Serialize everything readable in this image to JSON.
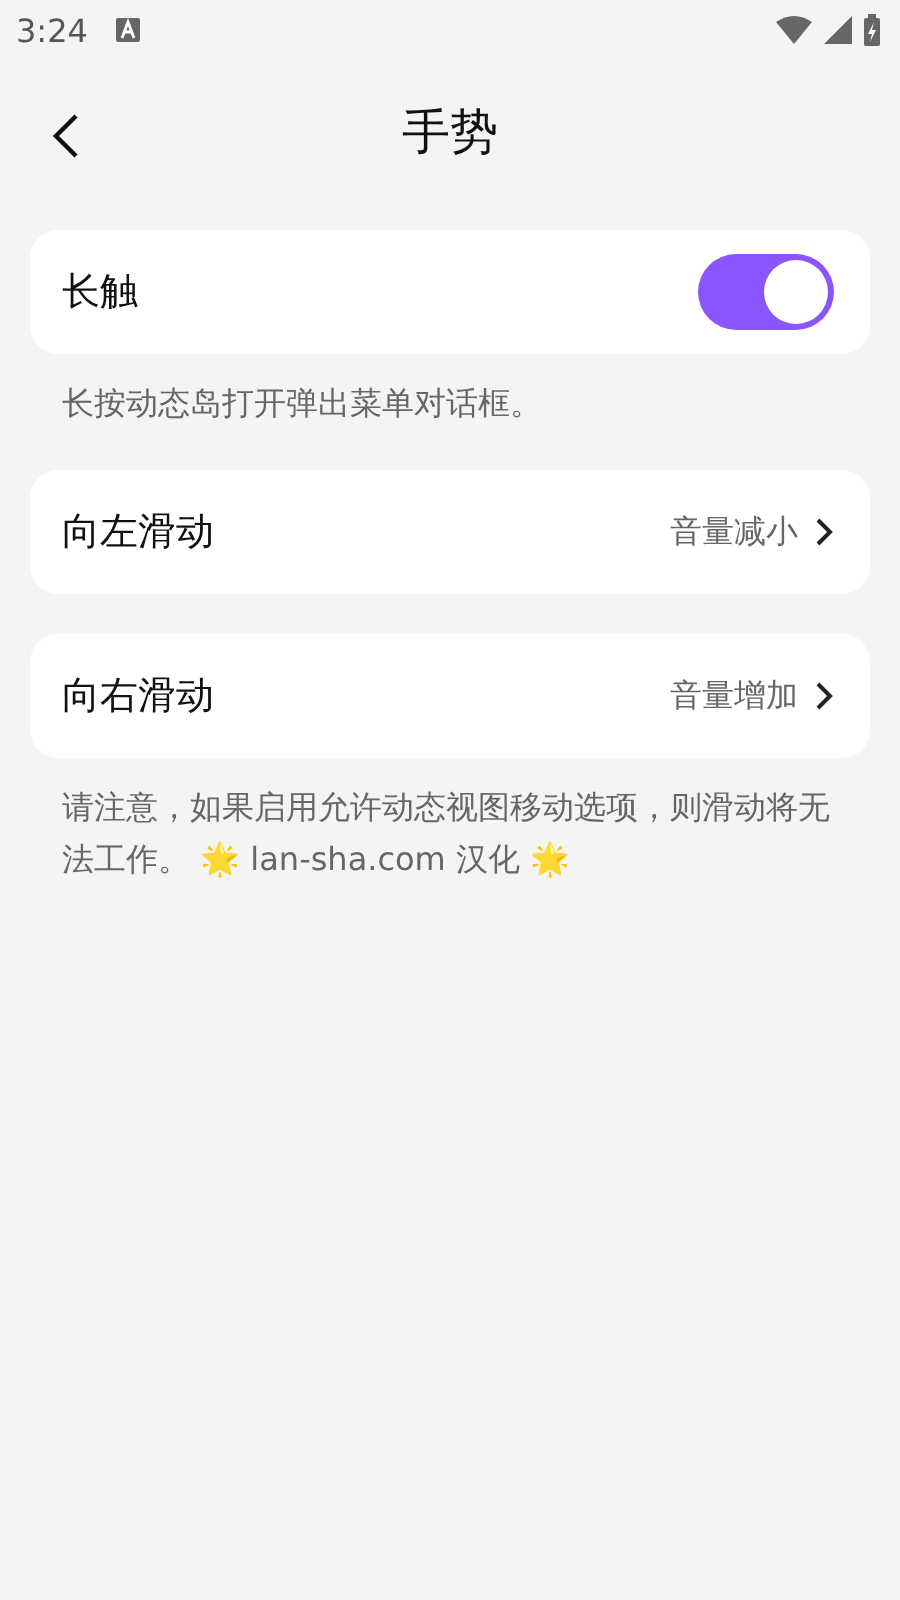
{
  "status_bar": {
    "time": "3:24"
  },
  "header": {
    "title": "手势"
  },
  "sections": [
    {
      "items": [
        {
          "kind": "toggle",
          "label": "长触",
          "on": true
        }
      ],
      "caption": "长按动态岛打开弹出菜单对话框。"
    },
    {
      "items": [
        {
          "kind": "nav",
          "label": "向左滑动",
          "value": "音量减小"
        }
      ]
    },
    {
      "items": [
        {
          "kind": "nav",
          "label": "向右滑动",
          "value": "音量增加"
        }
      ],
      "caption": "请注意，如果启用允许动态视图移动选项，则滑动将无法工作。 🌟 lan-sha.com 汉化 🌟"
    }
  ]
}
